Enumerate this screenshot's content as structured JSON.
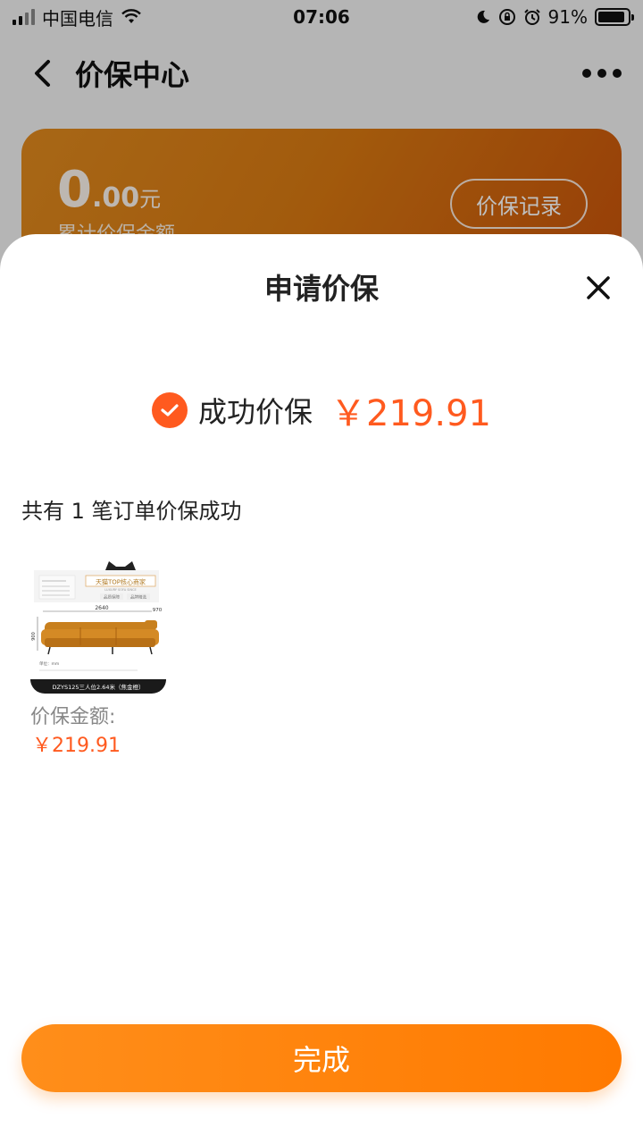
{
  "status_bar": {
    "carrier": "中国电信",
    "time": "07:06",
    "battery": "91%",
    "battery_level": 0.91
  },
  "nav": {
    "title": "价保中心"
  },
  "card": {
    "amount_int": "0",
    "amount_dec": ".00",
    "amount_unit": "元",
    "label": "累计价保金额",
    "records_button": "价保记录"
  },
  "sheet": {
    "title": "申请价保",
    "success_label": "成功价保",
    "success_amount": "￥219.91",
    "order_count": "共有 1 笔订单价保成功",
    "product": {
      "amount_label": "价保金额:",
      "amount": "￥219.91",
      "image_text": {
        "banner": "天猫TOP核心商家",
        "banner_sub": "LUXURY SOFA SINCE",
        "tag1": "品质保障",
        "tag2": "品牌精选",
        "width_dim": "2640",
        "depth_dim": "970",
        "height_dim": "900",
        "unit_note": "单位：mm",
        "caption": "DZYS125三人位2.64米（焦金橙）"
      }
    },
    "done_button": "完成"
  },
  "colors": {
    "accent": "#ff5a1f",
    "button": "#ff8000",
    "card_start": "#e08a1e",
    "card_end": "#c9520a"
  }
}
